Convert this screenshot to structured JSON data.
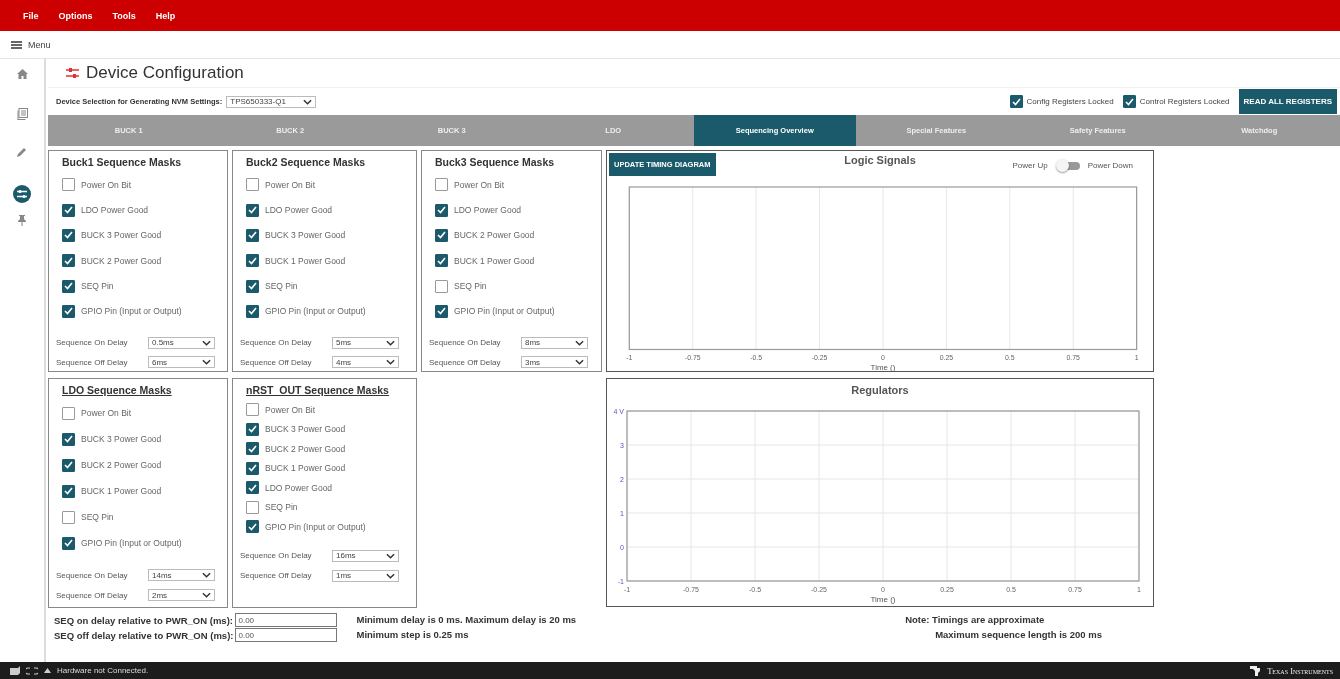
{
  "menu_bar": [
    "File",
    "Options",
    "Tools",
    "Help"
  ],
  "nav": {
    "menu_label": "Menu"
  },
  "sidebar": {
    "items": [
      {
        "kind": "home",
        "selected": false
      },
      {
        "kind": "list",
        "selected": false
      },
      {
        "kind": "pencil",
        "selected": false
      },
      {
        "kind": "config",
        "selected": true
      },
      {
        "kind": "pin",
        "selected": false
      }
    ]
  },
  "page": {
    "title": "Device Configuration"
  },
  "device_selection": {
    "label": "Device Selection for Generating NVM Settings:",
    "value": "TPS650333-Q1"
  },
  "locks": [
    {
      "label": "Config Registers Locked",
      "checked": true
    },
    {
      "label": "Control Registers Locked",
      "checked": true
    }
  ],
  "read_button": "READ ALL REGISTERS",
  "tabs": [
    {
      "label": "BUCK 1",
      "selected": false
    },
    {
      "label": "BUCK 2",
      "selected": false
    },
    {
      "label": "BUCK 3",
      "selected": false
    },
    {
      "label": "LDO",
      "selected": false
    },
    {
      "label": "Sequencing Overview",
      "selected": true
    },
    {
      "label": "Special Features",
      "selected": false
    },
    {
      "label": "Safety Features",
      "selected": false
    },
    {
      "label": "Watchdog",
      "selected": false
    }
  ],
  "mask_panels": [
    {
      "title": "Buck1 Sequence Masks",
      "underlined": false,
      "items": [
        {
          "label": "Power On Bit",
          "checked": false
        },
        {
          "label": "LDO Power Good",
          "checked": true
        },
        {
          "label": "BUCK 3 Power Good",
          "checked": true
        },
        {
          "label": "BUCK 2 Power Good",
          "checked": true
        },
        {
          "label": "SEQ Pin",
          "checked": true
        },
        {
          "label": "GPIO Pin (Input or Output)",
          "checked": true
        }
      ],
      "on_delay_label": "Sequence On Delay",
      "on_delay": "0.5ms",
      "off_delay_label": "Sequence Off Delay",
      "off_delay": "6ms"
    },
    {
      "title": "Buck2 Sequence Masks",
      "underlined": false,
      "items": [
        {
          "label": "Power On Bit",
          "checked": false
        },
        {
          "label": "LDO Power Good",
          "checked": true
        },
        {
          "label": "BUCK 3 Power Good",
          "checked": true
        },
        {
          "label": "BUCK 1 Power Good",
          "checked": true
        },
        {
          "label": "SEQ Pin",
          "checked": true
        },
        {
          "label": "GPIO Pin (Input or Output)",
          "checked": true
        }
      ],
      "on_delay_label": "Sequence On Delay",
      "on_delay": "5ms",
      "off_delay_label": "Sequence Off Delay",
      "off_delay": "4ms"
    },
    {
      "title": "Buck3 Sequence Masks",
      "underlined": false,
      "items": [
        {
          "label": "Power On Bit",
          "checked": false
        },
        {
          "label": "LDO Power Good",
          "checked": true
        },
        {
          "label": "BUCK 2 Power Good",
          "checked": true
        },
        {
          "label": "BUCK 1 Power Good",
          "checked": true
        },
        {
          "label": "SEQ Pin",
          "checked": false
        },
        {
          "label": "GPIO Pin (Input or Output)",
          "checked": true
        }
      ],
      "on_delay_label": "Sequence On Delay",
      "on_delay": "8ms",
      "off_delay_label": "Sequence Off Delay",
      "off_delay": "3ms"
    },
    {
      "title": "LDO Sequence Masks",
      "underlined": true,
      "items": [
        {
          "label": "Power On Bit",
          "checked": false
        },
        {
          "label": "BUCK 3 Power Good",
          "checked": true
        },
        {
          "label": "BUCK 2 Power Good",
          "checked": true
        },
        {
          "label": "BUCK 1 Power Good",
          "checked": true
        },
        {
          "label": "SEQ Pin",
          "checked": false
        },
        {
          "label": "GPIO Pin (Input or Output)",
          "checked": true
        }
      ],
      "on_delay_label": "Sequence On Delay",
      "on_delay": "14ms",
      "off_delay_label": "Sequence Off Delay",
      "off_delay": "2ms"
    },
    {
      "title": "nRST_OUT Sequence Masks",
      "underlined": true,
      "items": [
        {
          "label": "Power On Bit",
          "checked": false
        },
        {
          "label": "BUCK 3 Power Good",
          "checked": true
        },
        {
          "label": "BUCK 2 Power Good",
          "checked": true
        },
        {
          "label": "BUCK 1 Power Good",
          "checked": true
        },
        {
          "label": "LDO Power Good",
          "checked": true
        },
        {
          "label": "SEQ Pin",
          "checked": false
        },
        {
          "label": "GPIO Pin (Input or Output)",
          "checked": true
        }
      ],
      "on_delay_label": "Sequence On Delay",
      "on_delay": "16ms",
      "off_delay_label": "Sequence Off Delay",
      "off_delay": "1ms"
    }
  ],
  "logic_panel": {
    "update_button": "UPDATE TIMING DIAGRAM",
    "toggle": {
      "left_label": "Power Up",
      "right_label": "Power Down",
      "on": false
    },
    "plot": {
      "title": "Logic Signals",
      "xlabel": "Time ()",
      "axis_labels": [
        "-1",
        "-0.75",
        "-0.5",
        "-0.25",
        "0",
        "0.25",
        "0.5",
        "0.75",
        "1"
      ]
    }
  },
  "regulators_panel": {
    "chart_data": {
      "type": "line",
      "title": "Regulators",
      "xlabel": "Time ()",
      "grid": true,
      "xlim": [
        -1,
        1
      ],
      "ylim": [
        -1,
        4
      ],
      "xticks": [
        -1,
        -0.75,
        -0.5,
        -0.25,
        0,
        0.25,
        0.5,
        0.75,
        1
      ],
      "yticks": [
        -1,
        0,
        1,
        2,
        3,
        {
          "value": 4,
          "label": "4 V"
        }
      ]
    }
  },
  "seq_fields": [
    {
      "label": "SEQ on delay relative to PWR_ON (ms):",
      "value": "0.00"
    },
    {
      "label": "SEQ off delay relative to PWR_ON (ms):",
      "value": "0.00"
    }
  ],
  "limits": [
    "Minimum delay is 0 ms. Maximum delay is 20 ms",
    "Minimum step is 0.25 ms"
  ],
  "notes": [
    "Note: Timings are approximate",
    "Maximum sequence length is 200 ms"
  ],
  "status_bar": {
    "connection": "Hardware not Connected.",
    "brand": "Texas Instruments"
  }
}
